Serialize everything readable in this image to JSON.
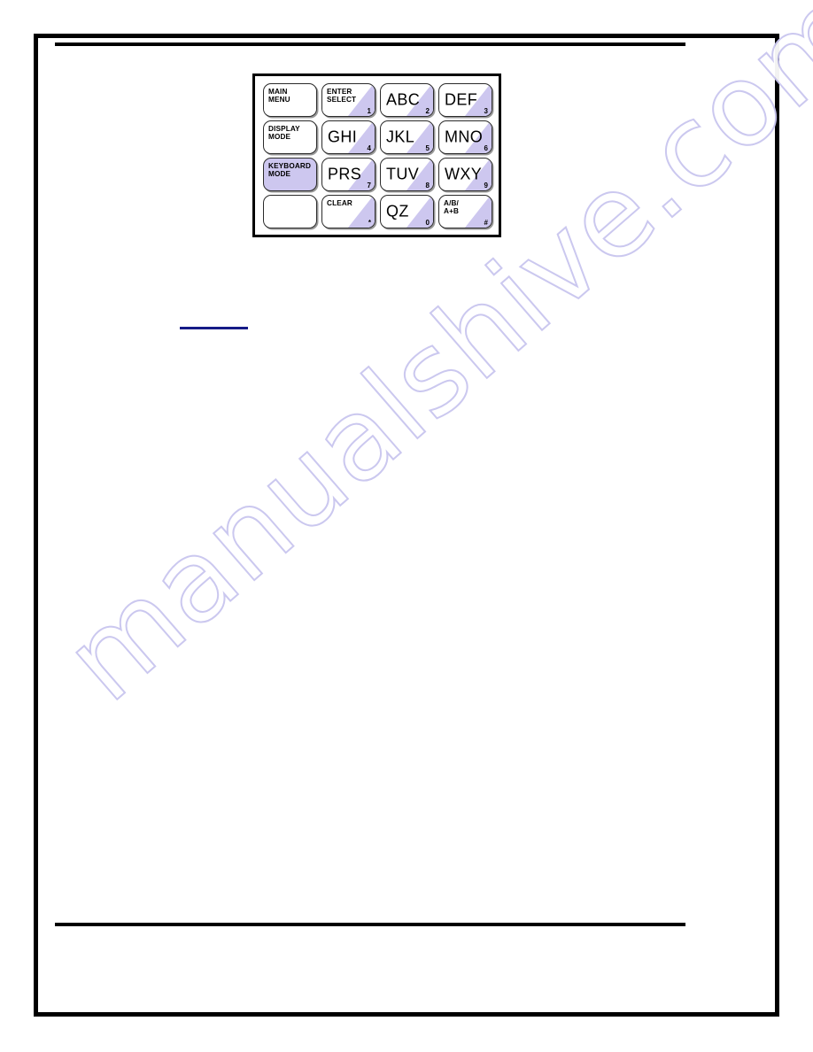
{
  "document": {
    "watermark": "manualshive.com",
    "header_rule": "",
    "footer_rule": "",
    "hidden_link_underline": ""
  },
  "colors": {
    "key_fill_purple": "#cdc7ef",
    "key_border": "#2b2b2b",
    "page_border": "#000000",
    "link_underline": "#151b87",
    "watermark_stroke": "#c9c6ef"
  },
  "figure": {
    "name": "telephone-style-keypad",
    "rows": 4,
    "columns": 4,
    "keys": [
      {
        "id": "main-menu",
        "label": "MAIN\nMENU",
        "digit": "",
        "size": "small",
        "wedge": false,
        "filled": false
      },
      {
        "id": "enter-select",
        "label": "ENTER\nSELECT",
        "digit": "1",
        "size": "small",
        "wedge": true,
        "filled": false
      },
      {
        "id": "abc",
        "label": "ABC",
        "digit": "2",
        "size": "big",
        "wedge": true,
        "filled": false
      },
      {
        "id": "def",
        "label": "DEF",
        "digit": "3",
        "size": "big",
        "wedge": true,
        "filled": false
      },
      {
        "id": "display-mode",
        "label": "DISPLAY\nMODE",
        "digit": "",
        "size": "small",
        "wedge": false,
        "filled": false
      },
      {
        "id": "ghi",
        "label": "GHI",
        "digit": "4",
        "size": "big",
        "wedge": true,
        "filled": false
      },
      {
        "id": "jkl",
        "label": "JKL",
        "digit": "5",
        "size": "big",
        "wedge": true,
        "filled": false
      },
      {
        "id": "mno",
        "label": "MNO",
        "digit": "6",
        "size": "big",
        "wedge": true,
        "filled": false
      },
      {
        "id": "keyboard-mode",
        "label": "KEYBOARD\nMODE",
        "digit": "",
        "size": "small",
        "wedge": false,
        "filled": true
      },
      {
        "id": "prs",
        "label": "PRS",
        "digit": "7",
        "size": "big",
        "wedge": true,
        "filled": false
      },
      {
        "id": "tuv",
        "label": "TUV",
        "digit": "8",
        "size": "big",
        "wedge": true,
        "filled": false
      },
      {
        "id": "wxy",
        "label": "WXY",
        "digit": "9",
        "size": "big",
        "wedge": true,
        "filled": false
      },
      {
        "id": "blank",
        "label": "",
        "digit": "",
        "size": "small",
        "wedge": false,
        "filled": false
      },
      {
        "id": "clear",
        "label": "CLEAR",
        "digit": "*",
        "size": "small",
        "wedge": true,
        "filled": false
      },
      {
        "id": "qz",
        "label": "QZ",
        "digit": "0",
        "size": "big",
        "wedge": true,
        "filled": false
      },
      {
        "id": "ab-aplusb",
        "label": "A/B/\nA+B",
        "digit": "#",
        "size": "small",
        "wedge": true,
        "filled": false
      }
    ]
  }
}
